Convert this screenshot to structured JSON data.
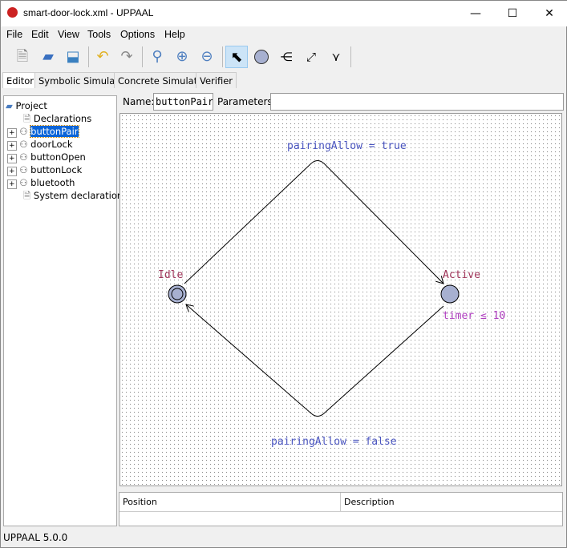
{
  "window": {
    "title": "smart-door-lock.xml - UPPAAL",
    "min": "—",
    "max": "☐",
    "close": "✕"
  },
  "menu": [
    "File",
    "Edit",
    "View",
    "Tools",
    "Options",
    "Help"
  ],
  "toolbar": {
    "icons": [
      "new-icon",
      "open-icon",
      "save-icon",
      "undo-icon",
      "redo-icon",
      "zoom-fit-icon",
      "zoom-in-icon",
      "zoom-out-icon",
      "select-tool-icon",
      "location-tool-icon",
      "branch-tool-icon",
      "edge-tool-icon",
      "nail-tool-icon"
    ]
  },
  "tabs": [
    "Editor",
    "Symbolic Simulator",
    "Concrete Simulator",
    "Verifier"
  ],
  "tree": {
    "root": "Project",
    "items": [
      {
        "label": "Declarations",
        "type": "doc"
      },
      {
        "label": "buttonPair",
        "type": "template",
        "selected": true
      },
      {
        "label": "doorLock",
        "type": "template"
      },
      {
        "label": "buttonOpen",
        "type": "template"
      },
      {
        "label": "buttonLock",
        "type": "template"
      },
      {
        "label": "bluetooth",
        "type": "template"
      },
      {
        "label": "System declarations",
        "type": "doc"
      }
    ]
  },
  "template": {
    "name_label": "Name:",
    "name": "buttonPair",
    "params_label": "Parameters:",
    "params": ""
  },
  "automaton": {
    "locations": [
      {
        "name": "Idle",
        "initial": true
      },
      {
        "name": "Active",
        "invariant": "timer ≤ 10"
      }
    ],
    "edges": [
      {
        "from": "Idle",
        "to": "Active",
        "update": "pairingAllow = true"
      },
      {
        "from": "Active",
        "to": "Idle",
        "update": "pairingAllow = false"
      }
    ],
    "colors": {
      "location": "#a7b0d0",
      "name": "#a0365a",
      "invariant": "#b040c0",
      "update": "#4a55c0"
    }
  },
  "table": {
    "columns": [
      "Position",
      "Description"
    ]
  },
  "status": "UPPAAL 5.0.0"
}
